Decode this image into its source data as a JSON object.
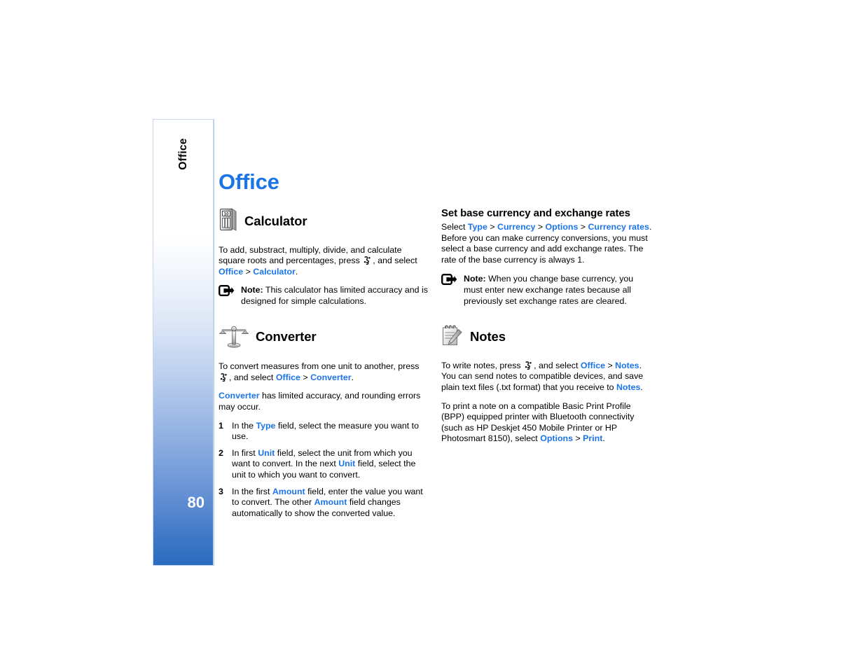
{
  "page": {
    "number": "80",
    "tab_label": "Office",
    "accent_color": "#1b75e8",
    "tab_gradient_end": "#2a6cbf"
  },
  "chapter": {
    "title": "Office"
  },
  "left_column": {
    "calculator": {
      "icon": "calculator-icon",
      "title": "Calculator",
      "paragraph_1": {
        "pre": "To add, substract, multiply, divide, and calculate square roots and percentages, press ",
        "key": "menu-key-glyph",
        "mid": ", and select ",
        "link_1": "Office",
        "sep_1": " > ",
        "link_2": "Calculator",
        "post": "."
      },
      "note": {
        "icon": "note-arrow-icon",
        "label": "Note:",
        "text": " This calculator has limited accuracy and is designed for simple calculations."
      }
    },
    "converter": {
      "icon": "scale-balance-icon",
      "title": "Converter",
      "paragraph_1": {
        "pre": "To convert measures from one unit to another, press ",
        "key": "menu-key-glyph",
        "mid": ", and select ",
        "link_1": "Office",
        "sep_1": " > ",
        "link_2": "Converter",
        "post": "."
      },
      "paragraph_2": {
        "link_1": "Converter",
        "text": " has limited accuracy, and rounding errors may occur."
      },
      "steps": [
        {
          "num": "1",
          "parts": [
            {
              "t": "In the ",
              "k": "plain"
            },
            {
              "t": "Type",
              "k": "link"
            },
            {
              "t": " field, select the measure you want to use.",
              "k": "plain"
            }
          ]
        },
        {
          "num": "2",
          "parts": [
            {
              "t": "In first ",
              "k": "plain"
            },
            {
              "t": "Unit",
              "k": "link"
            },
            {
              "t": " field, select the unit from which you want to convert. In the next ",
              "k": "plain"
            },
            {
              "t": "Unit",
              "k": "link"
            },
            {
              "t": " field, select the unit to which you want to convert.",
              "k": "plain"
            }
          ]
        },
        {
          "num": "3",
          "parts": [
            {
              "t": "In the first ",
              "k": "plain"
            },
            {
              "t": "Amount",
              "k": "link"
            },
            {
              "t": " field, enter the value you want to convert. The other ",
              "k": "plain"
            },
            {
              "t": "Amount",
              "k": "link"
            },
            {
              "t": " field changes automatically to show the converted value.",
              "k": "plain"
            }
          ]
        }
      ]
    }
  },
  "right_column": {
    "currency": {
      "heading": "Set base currency and exchange rates",
      "paragraph_1": {
        "pre": "Select ",
        "link_1": "Type",
        "sep_1": " > ",
        "link_2": "Currency",
        "sep_2": " > ",
        "link_3": "Options",
        "sep_3": " > ",
        "link_4": "Currency rates",
        "post": ". Before you can make currency conversions, you must select a base currency and add exchange rates. The rate of the base currency is always 1."
      },
      "note": {
        "icon": "note-arrow-icon",
        "label": "Note:",
        "text": " When you change base currency, you must enter new exchange rates because all previously set exchange rates are cleared."
      }
    },
    "notes": {
      "icon": "notepad-pencil-icon",
      "title": "Notes",
      "paragraph_1": {
        "pre": "To write notes, press ",
        "key": "menu-key-glyph",
        "mid": ", and select ",
        "link_1": "Office",
        "sep_1": " > ",
        "link_2": "Notes",
        "mid_2": ". You can send notes to compatible devices, and save plain text files (.txt format) that you receive to ",
        "link_3": "Notes",
        "post": "."
      },
      "paragraph_2": {
        "pre": "To print a note on a compatible Basic Print Profile (BPP) equipped printer with Bluetooth connectivity (such as HP Deskjet 450 Mobile Printer or HP Photosmart 8150), select ",
        "link_1": "Options",
        "sep_1": " > ",
        "link_2": "Print",
        "post": "."
      }
    }
  }
}
